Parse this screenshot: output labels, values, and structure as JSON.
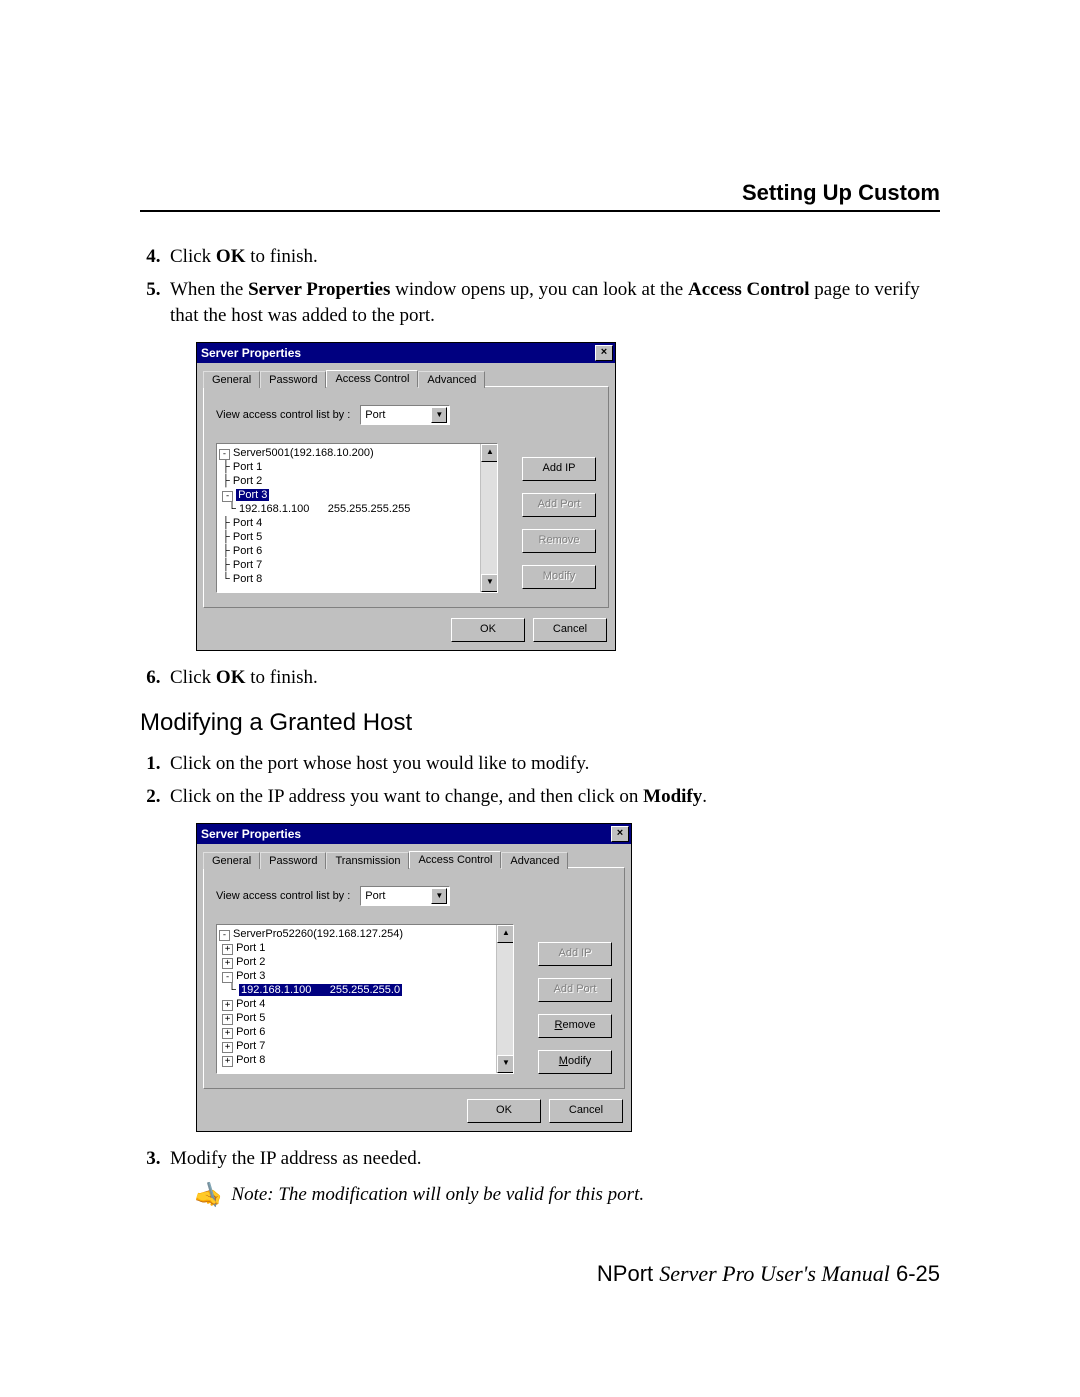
{
  "header": {
    "title": "Setting Up Custom"
  },
  "steps_a": [
    {
      "num": "4.",
      "pre": "Click ",
      "bold": "OK",
      "post": " to finish."
    },
    {
      "num": "5.",
      "pre": "When the ",
      "bold": "Server Properties",
      "mid": " window opens up, you can look at the ",
      "bold2": "Access Control",
      "post": " page to verify that the host was added to the port."
    }
  ],
  "steps_b": [
    {
      "num": "6.",
      "pre": "Click ",
      "bold": "OK",
      "post": " to finish."
    }
  ],
  "section2": {
    "title": "Modifying a Granted Host"
  },
  "steps_c": [
    {
      "num": "1.",
      "text": "Click on the port whose host you would like to modify."
    },
    {
      "num": "2.",
      "pre": "Click on the IP address you want to change, and then click on ",
      "bold": "Modify",
      "post": "."
    }
  ],
  "steps_d": [
    {
      "num": "3.",
      "text": "Modify the IP address as needed."
    }
  ],
  "note": {
    "text": "Note: The modification will only be valid for this port."
  },
  "footer": {
    "brand": "NPort ",
    "ital": "Server Pro User's Manual",
    "page": "  6-25"
  },
  "dialog1": {
    "title": "Server Properties",
    "tabs": [
      "General",
      "Password",
      "Access Control",
      "Advanced"
    ],
    "active_tab": 2,
    "view_label": "View access control list by :",
    "view_value": "Port",
    "tree_root": "Server5001(192.168.10.200)",
    "ports_before": [
      "Port 1",
      "Port 2"
    ],
    "sel_port": "Port 3",
    "sel_ip": "192.168.1.100",
    "sel_mask": "255.255.255.255",
    "ports_after": [
      "Port 4",
      "Port 5",
      "Port 6",
      "Port 7",
      "Port 8"
    ],
    "btn_addip": "Add IP",
    "btn_addport": "Add Port",
    "btn_remove": "Remove",
    "btn_modify": "Modify",
    "btn_ok": "OK",
    "btn_cancel": "Cancel"
  },
  "dialog2": {
    "title": "Server Properties",
    "tabs": [
      "General",
      "Password",
      "Transmission",
      "Access Control",
      "Advanced"
    ],
    "active_tab": 3,
    "view_label": "View access control list by :",
    "view_value": "Port",
    "tree_root": "ServerPro52260(192.168.127.254)",
    "ports_before": [
      "Port 1",
      "Port 2",
      "Port 3"
    ],
    "sel_ip": "192.168.1.100",
    "sel_mask": "255.255.255.0",
    "ports_after": [
      "Port 4",
      "Port 5",
      "Port 6",
      "Port 7",
      "Port 8"
    ],
    "btn_addip": "Add IP",
    "btn_addport": "Add Port",
    "btn_remove_u": "R",
    "btn_remove_rest": "emove",
    "btn_modify_u": "M",
    "btn_modify_rest": "odify",
    "btn_ok": "OK",
    "btn_cancel": "Cancel"
  }
}
